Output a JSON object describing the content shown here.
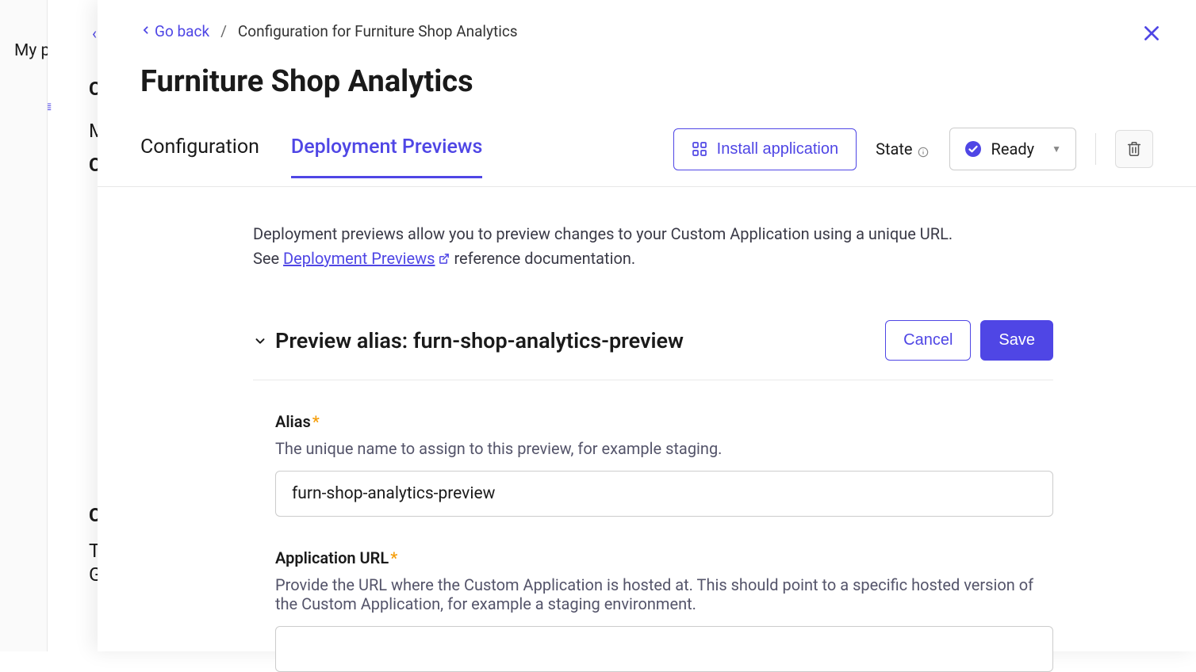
{
  "background": {
    "my_label": "My p",
    "partial_chars": [
      "C",
      "M",
      "C",
      "C",
      "T",
      "G"
    ],
    "list_icon": "≣"
  },
  "breadcrumb": {
    "go_back": "Go back",
    "separator": "/",
    "current": "Configuration for Furniture Shop Analytics"
  },
  "page": {
    "title": "Furniture Shop Analytics"
  },
  "tabs": {
    "configuration": "Configuration",
    "deployment_previews": "Deployment Previews"
  },
  "toolbar": {
    "install_label": "Install application",
    "state_label": "State",
    "state_value": "Ready"
  },
  "description": {
    "line1": "Deployment previews allow you to preview changes to your Custom Application using a unique URL.",
    "line2_prefix": "See ",
    "link_text": "Deployment Previews",
    "line2_suffix": " reference documentation."
  },
  "section": {
    "title_prefix": "Preview alias: ",
    "title_value": "furn-shop-analytics-preview",
    "cancel": "Cancel",
    "save": "Save"
  },
  "fields": {
    "alias": {
      "label": "Alias",
      "help": "The unique name to assign to this preview, for example staging.",
      "value": "furn-shop-analytics-preview"
    },
    "app_url": {
      "label": "Application URL",
      "help": "Provide the URL where the Custom Application is hosted at. This should point to a specific hosted version of the Custom Application, for example a staging environment.",
      "value": ""
    }
  }
}
